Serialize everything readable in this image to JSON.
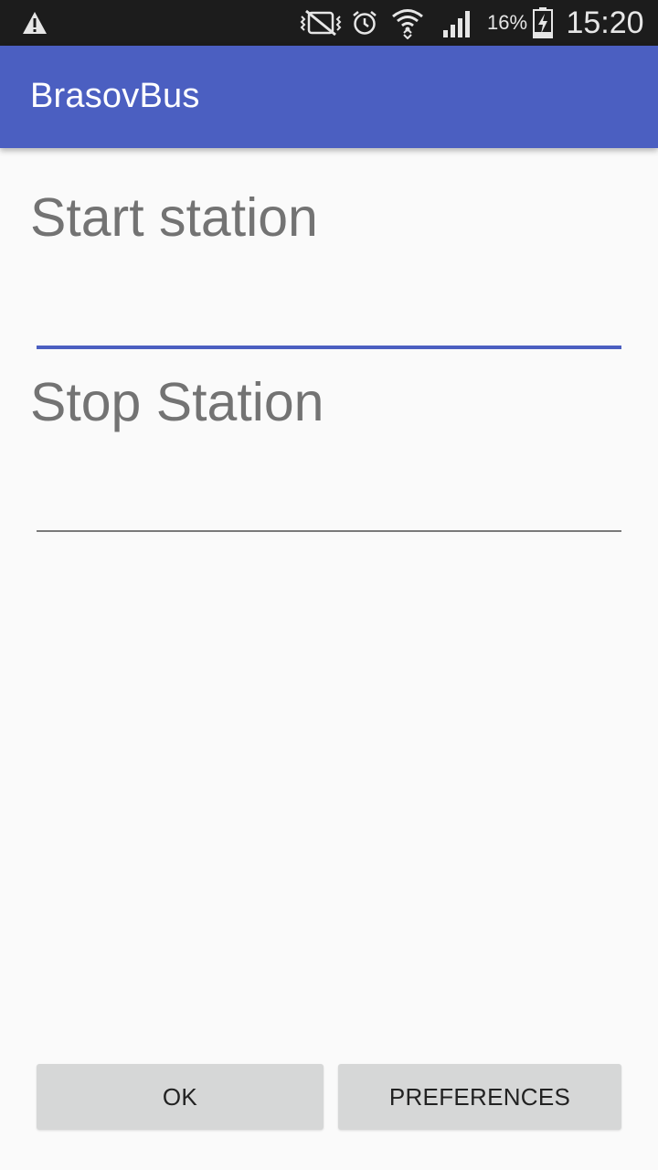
{
  "status_bar": {
    "icons": [
      "warning-icon",
      "vibrate-icon",
      "alarm-icon",
      "wifi-icon",
      "signal-icon",
      "battery-icon"
    ],
    "battery_percent": "16%",
    "time": "15:20"
  },
  "app_bar": {
    "title": "BrasovBus",
    "color": "#4b5fc1"
  },
  "form": {
    "start": {
      "label": "Start station",
      "value": "",
      "focused": true
    },
    "stop": {
      "label": "Stop Station",
      "value": ""
    }
  },
  "buttons": {
    "ok_label": "OK",
    "preferences_label": "PREFERENCES"
  }
}
